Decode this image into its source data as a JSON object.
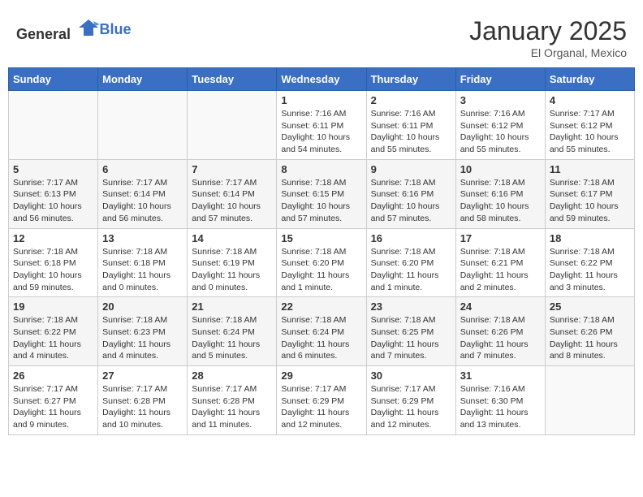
{
  "header": {
    "logo_general": "General",
    "logo_blue": "Blue",
    "month": "January 2025",
    "location": "El Organal, Mexico"
  },
  "days_of_week": [
    "Sunday",
    "Monday",
    "Tuesday",
    "Wednesday",
    "Thursday",
    "Friday",
    "Saturday"
  ],
  "weeks": [
    [
      {
        "day": "",
        "info": ""
      },
      {
        "day": "",
        "info": ""
      },
      {
        "day": "",
        "info": ""
      },
      {
        "day": "1",
        "info": "Sunrise: 7:16 AM\nSunset: 6:11 PM\nDaylight: 10 hours\nand 54 minutes."
      },
      {
        "day": "2",
        "info": "Sunrise: 7:16 AM\nSunset: 6:11 PM\nDaylight: 10 hours\nand 55 minutes."
      },
      {
        "day": "3",
        "info": "Sunrise: 7:16 AM\nSunset: 6:12 PM\nDaylight: 10 hours\nand 55 minutes."
      },
      {
        "day": "4",
        "info": "Sunrise: 7:17 AM\nSunset: 6:12 PM\nDaylight: 10 hours\nand 55 minutes."
      }
    ],
    [
      {
        "day": "5",
        "info": "Sunrise: 7:17 AM\nSunset: 6:13 PM\nDaylight: 10 hours\nand 56 minutes."
      },
      {
        "day": "6",
        "info": "Sunrise: 7:17 AM\nSunset: 6:14 PM\nDaylight: 10 hours\nand 56 minutes."
      },
      {
        "day": "7",
        "info": "Sunrise: 7:17 AM\nSunset: 6:14 PM\nDaylight: 10 hours\nand 57 minutes."
      },
      {
        "day": "8",
        "info": "Sunrise: 7:18 AM\nSunset: 6:15 PM\nDaylight: 10 hours\nand 57 minutes."
      },
      {
        "day": "9",
        "info": "Sunrise: 7:18 AM\nSunset: 6:16 PM\nDaylight: 10 hours\nand 57 minutes."
      },
      {
        "day": "10",
        "info": "Sunrise: 7:18 AM\nSunset: 6:16 PM\nDaylight: 10 hours\nand 58 minutes."
      },
      {
        "day": "11",
        "info": "Sunrise: 7:18 AM\nSunset: 6:17 PM\nDaylight: 10 hours\nand 59 minutes."
      }
    ],
    [
      {
        "day": "12",
        "info": "Sunrise: 7:18 AM\nSunset: 6:18 PM\nDaylight: 10 hours\nand 59 minutes."
      },
      {
        "day": "13",
        "info": "Sunrise: 7:18 AM\nSunset: 6:18 PM\nDaylight: 11 hours\nand 0 minutes."
      },
      {
        "day": "14",
        "info": "Sunrise: 7:18 AM\nSunset: 6:19 PM\nDaylight: 11 hours\nand 0 minutes."
      },
      {
        "day": "15",
        "info": "Sunrise: 7:18 AM\nSunset: 6:20 PM\nDaylight: 11 hours\nand 1 minute."
      },
      {
        "day": "16",
        "info": "Sunrise: 7:18 AM\nSunset: 6:20 PM\nDaylight: 11 hours\nand 1 minute."
      },
      {
        "day": "17",
        "info": "Sunrise: 7:18 AM\nSunset: 6:21 PM\nDaylight: 11 hours\nand 2 minutes."
      },
      {
        "day": "18",
        "info": "Sunrise: 7:18 AM\nSunset: 6:22 PM\nDaylight: 11 hours\nand 3 minutes."
      }
    ],
    [
      {
        "day": "19",
        "info": "Sunrise: 7:18 AM\nSunset: 6:22 PM\nDaylight: 11 hours\nand 4 minutes."
      },
      {
        "day": "20",
        "info": "Sunrise: 7:18 AM\nSunset: 6:23 PM\nDaylight: 11 hours\nand 4 minutes."
      },
      {
        "day": "21",
        "info": "Sunrise: 7:18 AM\nSunset: 6:24 PM\nDaylight: 11 hours\nand 5 minutes."
      },
      {
        "day": "22",
        "info": "Sunrise: 7:18 AM\nSunset: 6:24 PM\nDaylight: 11 hours\nand 6 minutes."
      },
      {
        "day": "23",
        "info": "Sunrise: 7:18 AM\nSunset: 6:25 PM\nDaylight: 11 hours\nand 7 minutes."
      },
      {
        "day": "24",
        "info": "Sunrise: 7:18 AM\nSunset: 6:26 PM\nDaylight: 11 hours\nand 7 minutes."
      },
      {
        "day": "25",
        "info": "Sunrise: 7:18 AM\nSunset: 6:26 PM\nDaylight: 11 hours\nand 8 minutes."
      }
    ],
    [
      {
        "day": "26",
        "info": "Sunrise: 7:17 AM\nSunset: 6:27 PM\nDaylight: 11 hours\nand 9 minutes."
      },
      {
        "day": "27",
        "info": "Sunrise: 7:17 AM\nSunset: 6:28 PM\nDaylight: 11 hours\nand 10 minutes."
      },
      {
        "day": "28",
        "info": "Sunrise: 7:17 AM\nSunset: 6:28 PM\nDaylight: 11 hours\nand 11 minutes."
      },
      {
        "day": "29",
        "info": "Sunrise: 7:17 AM\nSunset: 6:29 PM\nDaylight: 11 hours\nand 12 minutes."
      },
      {
        "day": "30",
        "info": "Sunrise: 7:17 AM\nSunset: 6:29 PM\nDaylight: 11 hours\nand 12 minutes."
      },
      {
        "day": "31",
        "info": "Sunrise: 7:16 AM\nSunset: 6:30 PM\nDaylight: 11 hours\nand 13 minutes."
      },
      {
        "day": "",
        "info": ""
      }
    ]
  ]
}
